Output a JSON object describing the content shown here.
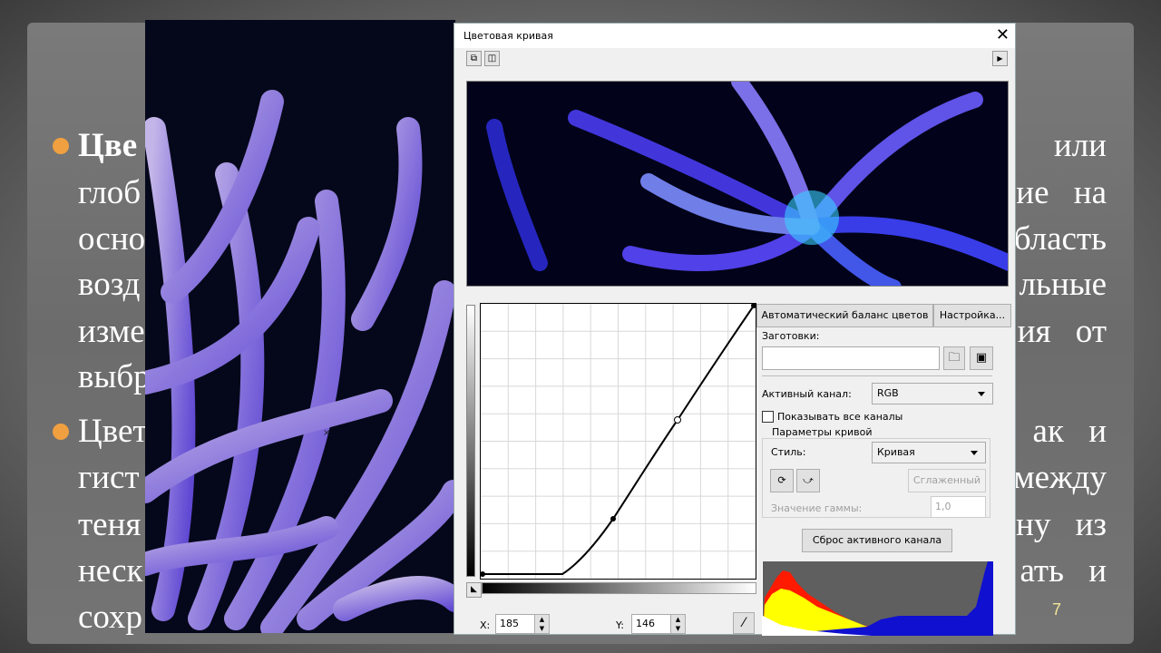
{
  "slide": {
    "lines_left": [
      "Цве",
      "глоб",
      "осно",
      "возд",
      "изме",
      "выбр",
      "Цвет",
      "гист",
      "теня",
      "неск",
      "сохр"
    ],
    "lines_right": [
      "или",
      "ие на",
      "бласть",
      "льные",
      "ия от",
      "ак и",
      "между",
      "ну из",
      "ать и"
    ],
    "page_number": "7",
    "bullet_color": "#f0a040"
  },
  "dialog": {
    "title": "Цветовая кривая",
    "close_icon": "close-icon",
    "auto_balance_label": "Автоматический баланс цветов",
    "settings_label": "Настройка...",
    "presets_label": "Заготовки:",
    "presets_value": "",
    "active_channel_label": "Активный канал:",
    "active_channel_value": "RGB",
    "show_all_channels_label": "Показывать все каналы",
    "show_all_channels_checked": false,
    "curve_params_label": "Параметры кривой",
    "style_label": "Стиль:",
    "style_value": "Кривая",
    "smooth_label": "Сглаженный",
    "gamma_label": "Значение гаммы:",
    "gamma_value": "1,0",
    "reset_label": "Сброс активного канала",
    "x_label": "X:",
    "x_value": "185",
    "y_label": "Y:",
    "y_value": "146"
  }
}
